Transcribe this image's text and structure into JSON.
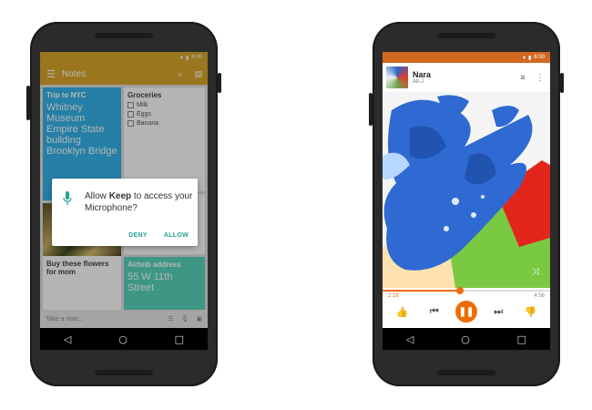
{
  "keep": {
    "status_time": "6:00",
    "toolbar_title": "Notes",
    "menu_icon": "menu-icon",
    "search_icon": "search-icon",
    "view_icon": "view-toggle-icon",
    "cards": {
      "trip": {
        "title": "Trip to NYC",
        "body": "Whitney Museum Empire State building Brooklyn Bridge"
      },
      "groceries": {
        "title": "Groceries",
        "items": [
          "Milk",
          "Eggs",
          "Banana"
        ]
      },
      "flowers": {
        "title": "Buy these flowers for mom"
      },
      "airbnb": {
        "title": "Airbnb address",
        "body": "55 W 11th Street"
      }
    },
    "dialog": {
      "prefix": "Allow ",
      "app": "Keep",
      "suffix": " to access your Microphone?",
      "deny": "DENY",
      "allow": "ALLOW"
    },
    "bottom_placeholder": "Take a note..."
  },
  "music": {
    "status_time": "6:00",
    "song_title": "Nara",
    "artist": "Alt-J",
    "elapsed": "2:16",
    "duration": "4:56",
    "progress": 0.46,
    "accent": "#ef6c00"
  }
}
